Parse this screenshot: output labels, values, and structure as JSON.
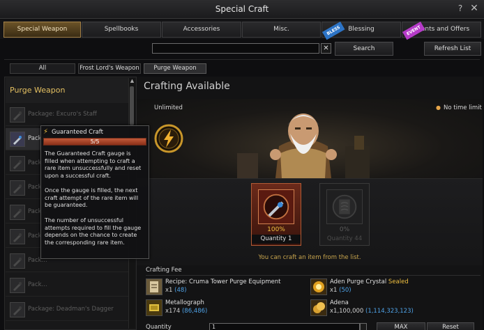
{
  "window": {
    "title": "Special Craft",
    "help_label": "?",
    "close_label": "✕"
  },
  "tabs": [
    {
      "label": "Special Weapon",
      "active": true
    },
    {
      "label": "Spellbooks"
    },
    {
      "label": "Accessories"
    },
    {
      "label": "Misc."
    },
    {
      "label": "Blessing",
      "ribbon": "BLESS"
    },
    {
      "label": "Events and Offers",
      "ribbon": "EVENT"
    }
  ],
  "search": {
    "value": "",
    "placeholder": "",
    "clear_label": "✕",
    "button_label": "Search"
  },
  "refresh_label": "Refresh List",
  "filters": [
    {
      "label": "All"
    },
    {
      "label": "Frost Lord's Weapon"
    },
    {
      "label": "Purge Weapon",
      "active": true
    }
  ],
  "list": {
    "header": "Purge Weapon",
    "items": [
      {
        "label": "Package: Excuro's Staff"
      },
      {
        "label": "Package...",
        "selected": true
      },
      {
        "label": "Pack..."
      },
      {
        "label": "Pack..."
      },
      {
        "label": "Pack..."
      },
      {
        "label": "Pack..."
      },
      {
        "label": "Pack..."
      },
      {
        "label": "Pack..."
      },
      {
        "label": "Package: Deadman's Dagger"
      }
    ]
  },
  "content": {
    "heading": "Crafting Available",
    "unlimited": "Unlimited",
    "time_limit": "No time limit",
    "slots": [
      {
        "percent": "100%",
        "quantity": "Quantity 1",
        "active": true
      },
      {
        "percent": "0%",
        "quantity": "Quantity 44",
        "active": false
      }
    ],
    "craft_message": "You can craft an item from the list.",
    "fee_label": "Crafting Fee",
    "materials": [
      {
        "name": "Recipe: Cruma Tower Purge Equipment",
        "tag": "",
        "count": "x1",
        "owned": "(48)"
      },
      {
        "name": "Aden Purge Crystal",
        "tag": "Sealed",
        "count": "x1",
        "owned": "(50)"
      },
      {
        "name": "Metallograph",
        "tag": "",
        "count": "x174",
        "owned": "(86,486)"
      },
      {
        "name": "Adena",
        "tag": "",
        "count": "x1,100,000",
        "owned": "(1,114,323,123)"
      }
    ],
    "quantity_label": "Quantity",
    "quantity_value": "1",
    "max_label": "MAX",
    "reset_label": "Reset"
  },
  "tooltip": {
    "title": "Guaranteed Craft",
    "gauge": "5/5",
    "gauge_fraction": 1.0,
    "paragraphs": [
      "The Guaranteed Craft gauge is filled when attempting to craft a rare item unsuccessfully and reset upon a successful craft.",
      "Once the gauge is filled, the next craft attempt of the rare item will be guaranteed.",
      "The number of unsuccessful attempts required to fill the gauge depends on the chance to create the corresponding rare item."
    ]
  },
  "colors": {
    "accent_gold": "#e4c062",
    "owned_blue": "#4fa3e8",
    "active_tab": "#6b5328"
  }
}
